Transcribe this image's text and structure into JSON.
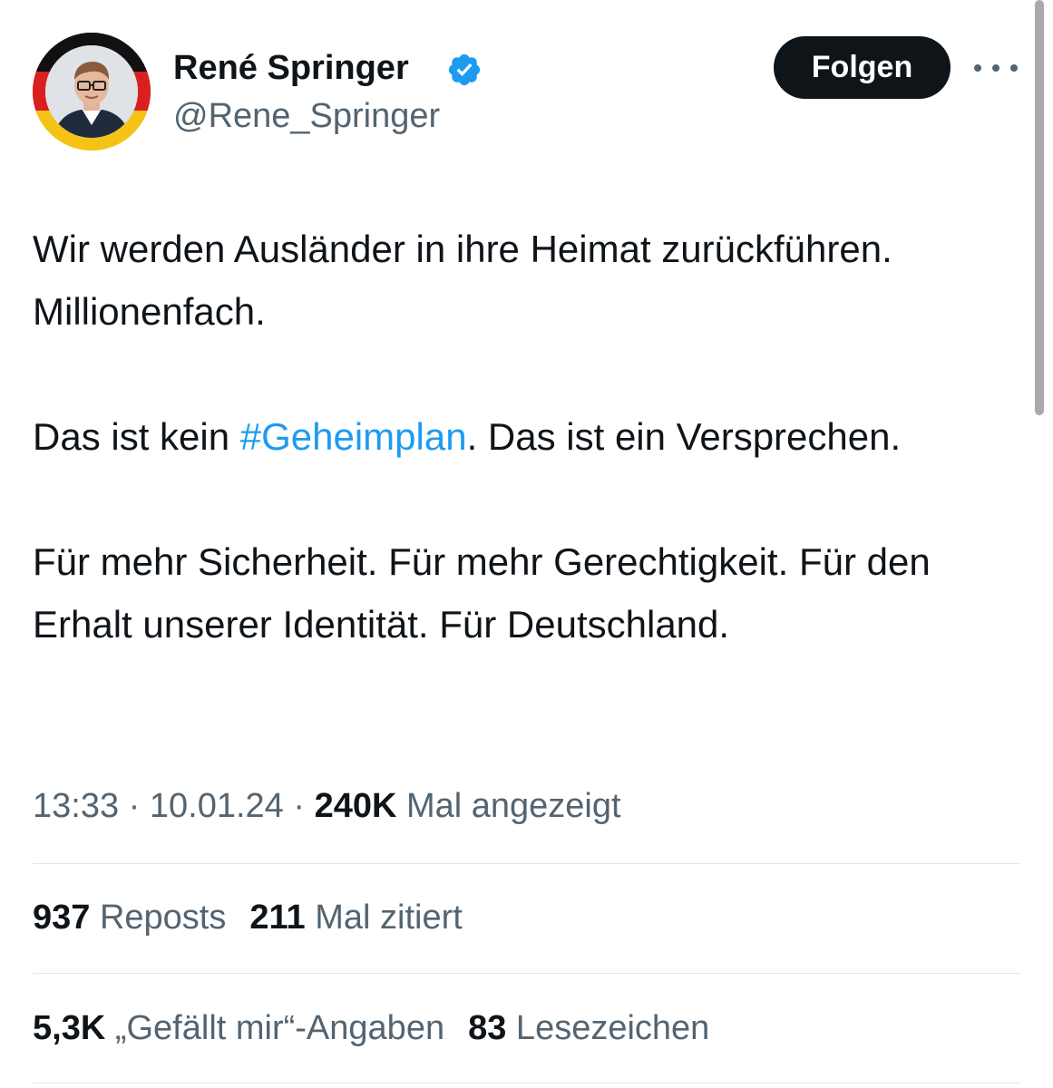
{
  "author": {
    "name": "René Springer",
    "handle": "@Rene_Springer",
    "verified": true
  },
  "follow_label": "Folgen",
  "tweet": {
    "part1": "Wir werden Ausländer in ihre Heimat zurückführen. Millionenfach.",
    "part2_before": "Das ist kein ",
    "hashtag": "#Geheimplan",
    "part2_after": ". Das ist ein Versprechen.",
    "part3": "Für mehr Sicherheit. Für mehr Gerechtigkeit. Für den Erhalt unserer Identität. Für Deutschland."
  },
  "meta": {
    "time": "13:33",
    "separator": " · ",
    "date": "10.01.24",
    "views_count": "240K",
    "views_label": " Mal angezeigt"
  },
  "stats": {
    "reposts_count": "937",
    "reposts_label": " Reposts",
    "quotes_count": "211",
    "quotes_label": " Mal zitiert",
    "likes_count": "5,3K",
    "likes_label": " „Gefällt mir“-Angaben",
    "bookmarks_count": "83",
    "bookmarks_label": " Lesezeichen"
  },
  "colors": {
    "accent": "#1d9bf0",
    "text_primary": "#0f1419",
    "text_secondary": "#536471",
    "button_bg": "#0f1419",
    "divider": "#e4e7ea"
  },
  "icons": {
    "verified": "verified-badge-icon",
    "more": "more-horizontal-icon"
  }
}
